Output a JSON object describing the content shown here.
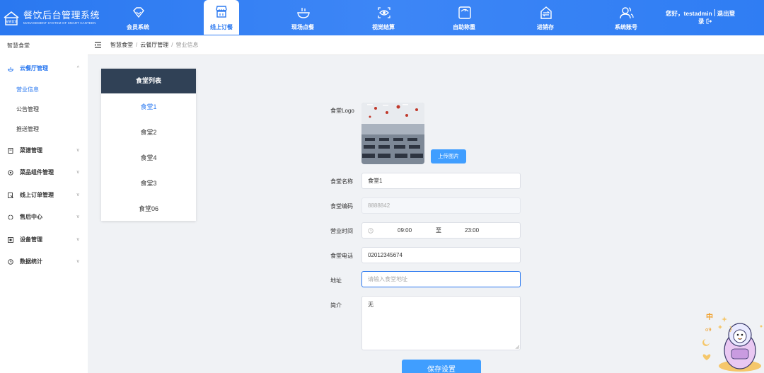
{
  "brand": {
    "title": "餐饮后台管理系统",
    "subtitle": "MANAGEMENT SYSTEM OF SMART CANTEEN",
    "logo_text": "智慧食堂"
  },
  "nav": [
    {
      "label": "会员系统",
      "icon": "diamond-icon"
    },
    {
      "label": "线上订餐",
      "icon": "storefront-icon",
      "active": true
    },
    {
      "label": "现场点餐",
      "icon": "dining-bowl-icon"
    },
    {
      "label": "视觉结算",
      "icon": "eye-scan-icon"
    },
    {
      "label": "自助称重",
      "icon": "scale-icon"
    },
    {
      "label": "进销存",
      "icon": "inventory-exchange-icon"
    },
    {
      "label": "系统账号",
      "icon": "users-icon"
    }
  ],
  "user": {
    "greeting": "您好，testadmin",
    "logout_a": "退出登",
    "logout_b": "录"
  },
  "sidebar": {
    "header": "智慧食堂",
    "items": [
      {
        "label": "云餐厅管理",
        "icon": "restaurant-icon",
        "open": true,
        "chevron": "^"
      },
      {
        "label": "菜谱管理",
        "icon": "book-icon",
        "chevron": "v"
      },
      {
        "label": "菜品组件管理",
        "icon": "component-icon",
        "chevron": "v"
      },
      {
        "label": "线上订单管理",
        "icon": "order-icon",
        "chevron": "v"
      },
      {
        "label": "售后中心",
        "icon": "refresh-icon",
        "chevron": "v"
      },
      {
        "label": "设备管理",
        "icon": "device-icon",
        "chevron": "v"
      },
      {
        "label": "数据统计",
        "icon": "clock-icon",
        "chevron": "v"
      }
    ],
    "sub_items": [
      "营业信息",
      "公告管理",
      "推送管理"
    ]
  },
  "breadcrumb": {
    "items": [
      "智慧食堂",
      "云餐厅管理",
      "营业信息"
    ],
    "separator": "/"
  },
  "canteen_list": {
    "title": "食堂列表",
    "items": [
      "食堂1",
      "食堂2",
      "食堂4",
      "食堂3",
      "食堂06"
    ]
  },
  "form": {
    "logo_label": "食堂Logo",
    "upload_label": "上传图片",
    "name_label": "食堂名称",
    "name_value": "食堂1",
    "code_label": "食堂编码",
    "code_value": "8888842",
    "hours_label": "营业时间",
    "hours_start": "09:00",
    "hours_sep": "至",
    "hours_end": "23:00",
    "phone_label": "食堂电话",
    "phone_value": "02012345674",
    "address_label": "地址",
    "address_placeholder": "请输入食堂地址",
    "intro_label": "简介",
    "intro_value": "无",
    "save_label": "保存设置"
  },
  "colors": {
    "primary": "#2a78f0",
    "button": "#409eff",
    "list_header": "#304156"
  }
}
